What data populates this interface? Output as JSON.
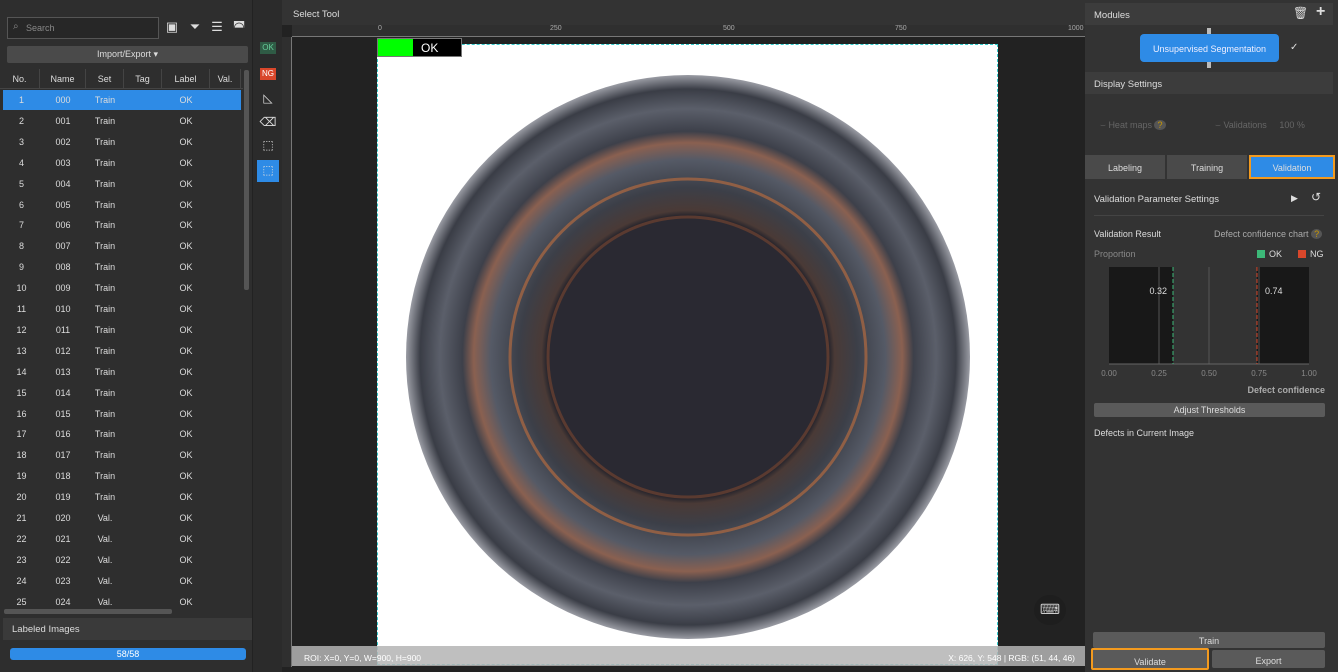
{
  "left_panel": {
    "search_placeholder": "Search",
    "import_export": "Import/Export ▾",
    "columns": [
      "No.",
      "Name",
      "Set",
      "Tag",
      "Label",
      "Val."
    ],
    "rows": [
      [
        "1",
        "000",
        "Train",
        "",
        "OK"
      ],
      [
        "2",
        "001",
        "Train",
        "",
        "OK"
      ],
      [
        "3",
        "002",
        "Train",
        "",
        "OK"
      ],
      [
        "4",
        "003",
        "Train",
        "",
        "OK"
      ],
      [
        "5",
        "004",
        "Train",
        "",
        "OK"
      ],
      [
        "6",
        "005",
        "Train",
        "",
        "OK"
      ],
      [
        "7",
        "006",
        "Train",
        "",
        "OK"
      ],
      [
        "8",
        "007",
        "Train",
        "",
        "OK"
      ],
      [
        "9",
        "008",
        "Train",
        "",
        "OK"
      ],
      [
        "10",
        "009",
        "Train",
        "",
        "OK"
      ],
      [
        "11",
        "010",
        "Train",
        "",
        "OK"
      ],
      [
        "12",
        "011",
        "Train",
        "",
        "OK"
      ],
      [
        "13",
        "012",
        "Train",
        "",
        "OK"
      ],
      [
        "14",
        "013",
        "Train",
        "",
        "OK"
      ],
      [
        "15",
        "014",
        "Train",
        "",
        "OK"
      ],
      [
        "16",
        "015",
        "Train",
        "",
        "OK"
      ],
      [
        "17",
        "016",
        "Train",
        "",
        "OK"
      ],
      [
        "18",
        "017",
        "Train",
        "",
        "OK"
      ],
      [
        "19",
        "018",
        "Train",
        "",
        "OK"
      ],
      [
        "20",
        "019",
        "Train",
        "",
        "OK"
      ],
      [
        "21",
        "020",
        "Val.",
        "",
        "OK"
      ],
      [
        "22",
        "021",
        "Val.",
        "",
        "OK"
      ],
      [
        "23",
        "022",
        "Val.",
        "",
        "OK"
      ],
      [
        "24",
        "023",
        "Val.",
        "",
        "OK"
      ],
      [
        "25",
        "024",
        "Val.",
        "",
        "OK"
      ]
    ],
    "selected_row": 0,
    "labeled_images": "Labeled Images",
    "progress": "58/58",
    "progress_fraction": 1.0
  },
  "tools": {
    "ok": "OK",
    "ng": "NG"
  },
  "canvas": {
    "title": "Select Tool",
    "ruler_labels": [
      "0",
      "250",
      "500",
      "750",
      "1000"
    ],
    "result_badge": "OK",
    "roi": "ROI: X=0, Y=0, W=900, H=900",
    "cursor": "X: 626, Y: 548 | RGB: (51, 44, 46)"
  },
  "right_panel": {
    "modules": "Modules",
    "module_name": "Unsupervised Segmentation",
    "display_settings": "Display Settings",
    "heat_maps": "Heat maps",
    "validations": "Validations",
    "validations_pct": "100 %",
    "tabs": [
      "Labeling",
      "Training",
      "Validation"
    ],
    "active_tab": 2,
    "param_settings": "Validation Parameter Settings",
    "validation_result": "Validation Result",
    "defect_chart": "Defect confidence chart",
    "adjust": "Adjust Thresholds",
    "defects_current": "Defects in Current Image",
    "train": "Train",
    "validate": "Validate",
    "export": "Export",
    "accent": "#2e8be6",
    "highlight": "#f39a1e"
  },
  "chart_data": {
    "type": "bar",
    "ylabel": "Proportion",
    "xlabel": "Defect confidence",
    "xlim": [
      0,
      1
    ],
    "x_ticks": [
      "0.00",
      "0.25",
      "0.50",
      "0.75",
      "1.00"
    ],
    "legend": [
      {
        "name": "OK",
        "color": "#3cb878"
      },
      {
        "name": "NG",
        "color": "#d9472b"
      }
    ],
    "thresholds": [
      {
        "value": 0.32,
        "label": "0.32",
        "color": "#3cb878"
      },
      {
        "value": 0.74,
        "label": "0.74",
        "color": "#d9472b"
      }
    ],
    "grid": true
  }
}
